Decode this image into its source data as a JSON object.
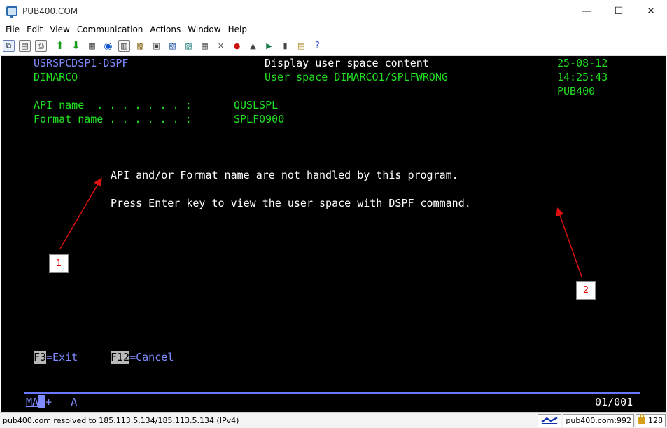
{
  "window": {
    "title": "PUB400.COM",
    "minimize": "—",
    "maximize": "☐",
    "close": "✕"
  },
  "menu": [
    "File",
    "Edit",
    "View",
    "Communication",
    "Actions",
    "Window",
    "Help"
  ],
  "toolbar_icons": [
    "copy-icon",
    "paste-icon",
    "print-icon",
    "send-icon",
    "receive-icon",
    "record-icon",
    "play-macro-icon",
    "keyboard-icon",
    "color-icon",
    "screen-icon",
    "grid-icon",
    "tools-icon",
    "stop-icon",
    "chart-icon",
    "disconnect-icon",
    "connect-icon",
    "notes-icon",
    "help-icon"
  ],
  "screen": {
    "program": "USRSPCDSP1-DSPF",
    "user": "DIMARCO",
    "heading": "Display user space content",
    "subheading": "User space DIMARCO1/SPLFWRONG",
    "date": "25-08-12",
    "time": "14:25:43",
    "system": "PUB400",
    "api_label": "API name  . . . . . . . :",
    "api_value": "QUSLSPL",
    "format_label": "Format name . . . . . . :",
    "format_value": "SPLF0900",
    "message1": "API and/or Format name are not handled by this program.",
    "message2": "Press Enter key to view the user space with DSPF command.",
    "f3_key": "F3",
    "f3_label": "=Exit",
    "f12_key": "F12",
    "f12_label": "=Cancel",
    "status_left_a": "MA",
    "status_left_b": "+",
    "status_left_c": "A",
    "cursor_pos": "01/001"
  },
  "annotations": {
    "label1": "1",
    "label2": "2",
    "color": "#dd1111"
  },
  "statusbar": {
    "message": "pub400.com resolved to 185.113.5.134/185.113.5.134 (IPv4)",
    "host": "pub400.com:992",
    "encryption": "128"
  }
}
